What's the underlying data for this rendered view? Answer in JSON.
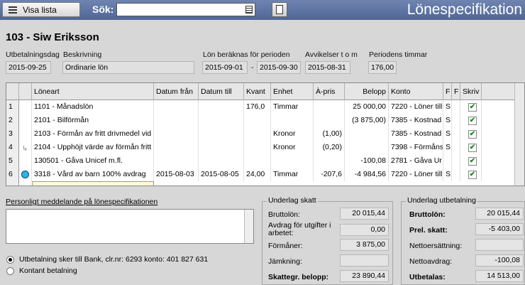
{
  "toolbar": {
    "visa_lista_label": "Visa lista",
    "sok_label": "Sök:",
    "sok_value": "",
    "window_title": "Lönespecifikation"
  },
  "employee": {
    "name": "103 - Siw Eriksson"
  },
  "payment": {
    "utbetalningsdag_label": "Utbetalningsdag",
    "beskrivning_label": "Beskrivning",
    "utbetalningsdag": "2015-09-25",
    "beskrivning": "Ordinarie lön",
    "period_label": "Lön beräknas för perioden",
    "period_from": "2015-09-01",
    "period_dash": "-",
    "period_to": "2015-09-30",
    "avvikelser_label": "Avvikelser t o m",
    "avvikelser": "2015-08-31",
    "timmar_label": "Periodens timmar",
    "timmar": "176,00"
  },
  "table": {
    "headers": [
      "",
      "",
      "Löneart",
      "Datum från",
      "Datum till",
      "Kvant",
      "Enhet",
      "À-pris",
      "Belopp",
      "Konto",
      "F",
      "F",
      "Skriv"
    ],
    "rows": [
      {
        "n": "1",
        "loneart": "1101 - Månadslön",
        "from": "",
        "to": "",
        "kvant": "176,0",
        "enhet": "Timmar",
        "apris": "",
        "belopp": "25 000,00",
        "konto": "7220 - Löner till",
        "f1": "S",
        "skriv": true
      },
      {
        "n": "2",
        "loneart": "2101 - Bilförmån",
        "from": "",
        "to": "",
        "kvant": "",
        "enhet": "",
        "apris": "",
        "belopp": "(3 875,00)",
        "konto": "7385 - Kostnad",
        "f1": "S",
        "skriv": true
      },
      {
        "n": "3",
        "loneart": "2103 - Förmån av fritt drivmedel vid",
        "from": "",
        "to": "",
        "kvant": "",
        "enhet": "Kronor",
        "apris": "(1,00)",
        "belopp": "",
        "konto": "7385 - Kostnad",
        "f1": "S",
        "skriv": true
      },
      {
        "n": "4",
        "loneart": "2104 - Upphöjt värde av förmån fritt",
        "from": "",
        "to": "",
        "kvant": "",
        "enhet": "Kronor",
        "apris": "(0,20)",
        "belopp": "",
        "konto": "7398 - Förmåns",
        "f1": "S",
        "skriv": true
      },
      {
        "n": "5",
        "loneart": "130501 - Gåva Unicef m.fl.",
        "from": "",
        "to": "",
        "kvant": "",
        "enhet": "",
        "apris": "",
        "belopp": "-100,08",
        "konto": "2781 - Gåva Ur",
        "f1": "",
        "skriv": true
      },
      {
        "n": "6",
        "loneart": "3318 - Vård av barn 100% avdrag",
        "from": "2015-08-03",
        "to": "2015-08-05",
        "kvant": "24,00",
        "enhet": "Timmar",
        "apris": "-207,6",
        "belopp": "-4 984,56",
        "konto": "7220 - Löner till",
        "f1": "S",
        "skriv": true
      }
    ]
  },
  "message": {
    "label": "Personligt meddelande på lönespecifikationen",
    "value": ""
  },
  "payout": {
    "bank_text": "Utbetalning sker till  Bank, clr.nr: 6293 konto: 401 827 631",
    "kontant_label": "Kontant betalning",
    "bank_selected": true
  },
  "underlag_skatt": {
    "title": "Underlag skatt",
    "brutto_label": "Bruttolön:",
    "brutto": "20 015,44",
    "avdrag_label": "Avdrag för utgifter i arbetet:",
    "avdrag": "0,00",
    "formaner_label": "Förmåner:",
    "formaner": "3 875,00",
    "jamkning_label": "Jämkning:",
    "jamkning": "",
    "skattegr_label": "Skattegr. belopp:",
    "skattegr": "23 890,44"
  },
  "underlag_utbetalning": {
    "title": "Underlag utbetalning",
    "brutto_label": "Bruttolön:",
    "brutto": "20 015,44",
    "prel_label": "Prel. skatt:",
    "prel": "-5 403,00",
    "netto_ers_label": "Nettoersättning:",
    "netto_ers": "",
    "nettoavdrag_label": "Nettoavdrag:",
    "nettoavdrag": "-100,08",
    "utbetalas_label": "Utbetalas:",
    "utbetalas": "14 513,00"
  }
}
